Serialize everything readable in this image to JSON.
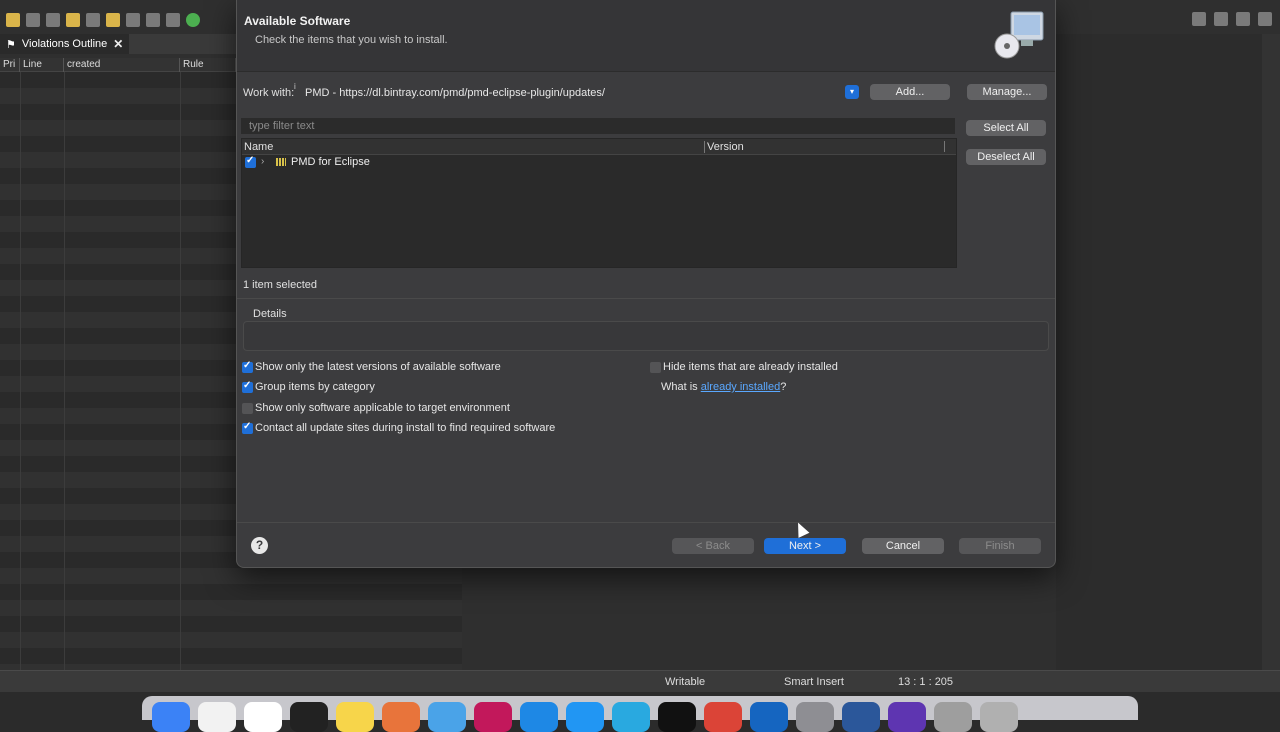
{
  "ide": {
    "view_tab": "Violations Outline",
    "columns": [
      "Pri",
      "Line",
      "created",
      "Rule"
    ],
    "status": {
      "writable": "Writable",
      "insert_mode": "Smart Insert",
      "position": "13 : 1 : 205"
    }
  },
  "dialog": {
    "title": "Available Software",
    "subtitle": "Check the items that you wish to install.",
    "work_with_label": "Work with:",
    "work_with_sup": "i",
    "work_with_value": "PMD - https://dl.bintray.com/pmd/pmd-eclipse-plugin/updates/",
    "add_button": "Add...",
    "manage_button": "Manage...",
    "filter_placeholder": "type filter text",
    "select_all": "Select All",
    "deselect_all": "Deselect All",
    "tree_columns": {
      "name": "Name",
      "version": "Version"
    },
    "tree_items": [
      {
        "label": "PMD for Eclipse",
        "checked": true
      }
    ],
    "selection_count": "1 item selected",
    "details_label": "Details",
    "options_left": [
      {
        "label": "Show only the latest versions of available software",
        "checked": true
      },
      {
        "label": "Group items by category",
        "checked": true
      },
      {
        "label": "Show only software applicable to target environment",
        "checked": false
      },
      {
        "label": "Contact all update sites during install to find required software",
        "checked": true
      }
    ],
    "options_right": {
      "hide_installed": {
        "label": "Hide items that are already installed",
        "checked": false
      }
    },
    "what_is_prefix": "What is ",
    "what_is_link": "already installed",
    "what_is_suffix": "?",
    "buttons": {
      "back": "< Back",
      "next": "Next >",
      "cancel": "Cancel",
      "finish": "Finish"
    },
    "help_glyph": "?"
  },
  "colors": {
    "accent": "#1f6fd8",
    "dialog_bg": "#3c3c3e",
    "link": "#5aa8ff"
  }
}
